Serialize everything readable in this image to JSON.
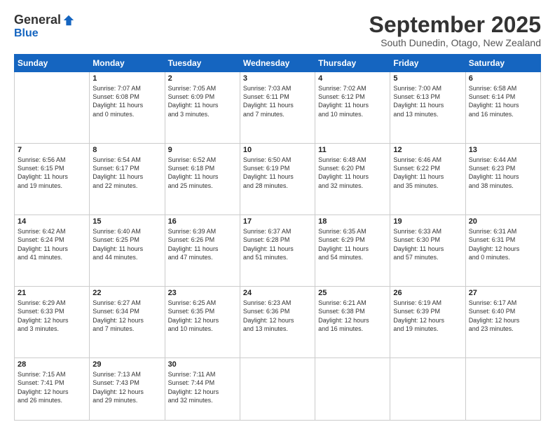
{
  "logo": {
    "general": "General",
    "blue": "Blue"
  },
  "header": {
    "month": "September 2025",
    "location": "South Dunedin, Otago, New Zealand"
  },
  "weekdays": [
    "Sunday",
    "Monday",
    "Tuesday",
    "Wednesday",
    "Thursday",
    "Friday",
    "Saturday"
  ],
  "weeks": [
    [
      {
        "day": "",
        "info": ""
      },
      {
        "day": "1",
        "info": "Sunrise: 7:07 AM\nSunset: 6:08 PM\nDaylight: 11 hours\nand 0 minutes."
      },
      {
        "day": "2",
        "info": "Sunrise: 7:05 AM\nSunset: 6:09 PM\nDaylight: 11 hours\nand 3 minutes."
      },
      {
        "day": "3",
        "info": "Sunrise: 7:03 AM\nSunset: 6:11 PM\nDaylight: 11 hours\nand 7 minutes."
      },
      {
        "day": "4",
        "info": "Sunrise: 7:02 AM\nSunset: 6:12 PM\nDaylight: 11 hours\nand 10 minutes."
      },
      {
        "day": "5",
        "info": "Sunrise: 7:00 AM\nSunset: 6:13 PM\nDaylight: 11 hours\nand 13 minutes."
      },
      {
        "day": "6",
        "info": "Sunrise: 6:58 AM\nSunset: 6:14 PM\nDaylight: 11 hours\nand 16 minutes."
      }
    ],
    [
      {
        "day": "7",
        "info": "Sunrise: 6:56 AM\nSunset: 6:15 PM\nDaylight: 11 hours\nand 19 minutes."
      },
      {
        "day": "8",
        "info": "Sunrise: 6:54 AM\nSunset: 6:17 PM\nDaylight: 11 hours\nand 22 minutes."
      },
      {
        "day": "9",
        "info": "Sunrise: 6:52 AM\nSunset: 6:18 PM\nDaylight: 11 hours\nand 25 minutes."
      },
      {
        "day": "10",
        "info": "Sunrise: 6:50 AM\nSunset: 6:19 PM\nDaylight: 11 hours\nand 28 minutes."
      },
      {
        "day": "11",
        "info": "Sunrise: 6:48 AM\nSunset: 6:20 PM\nDaylight: 11 hours\nand 32 minutes."
      },
      {
        "day": "12",
        "info": "Sunrise: 6:46 AM\nSunset: 6:22 PM\nDaylight: 11 hours\nand 35 minutes."
      },
      {
        "day": "13",
        "info": "Sunrise: 6:44 AM\nSunset: 6:23 PM\nDaylight: 11 hours\nand 38 minutes."
      }
    ],
    [
      {
        "day": "14",
        "info": "Sunrise: 6:42 AM\nSunset: 6:24 PM\nDaylight: 11 hours\nand 41 minutes."
      },
      {
        "day": "15",
        "info": "Sunrise: 6:40 AM\nSunset: 6:25 PM\nDaylight: 11 hours\nand 44 minutes."
      },
      {
        "day": "16",
        "info": "Sunrise: 6:39 AM\nSunset: 6:26 PM\nDaylight: 11 hours\nand 47 minutes."
      },
      {
        "day": "17",
        "info": "Sunrise: 6:37 AM\nSunset: 6:28 PM\nDaylight: 11 hours\nand 51 minutes."
      },
      {
        "day": "18",
        "info": "Sunrise: 6:35 AM\nSunset: 6:29 PM\nDaylight: 11 hours\nand 54 minutes."
      },
      {
        "day": "19",
        "info": "Sunrise: 6:33 AM\nSunset: 6:30 PM\nDaylight: 11 hours\nand 57 minutes."
      },
      {
        "day": "20",
        "info": "Sunrise: 6:31 AM\nSunset: 6:31 PM\nDaylight: 12 hours\nand 0 minutes."
      }
    ],
    [
      {
        "day": "21",
        "info": "Sunrise: 6:29 AM\nSunset: 6:33 PM\nDaylight: 12 hours\nand 3 minutes."
      },
      {
        "day": "22",
        "info": "Sunrise: 6:27 AM\nSunset: 6:34 PM\nDaylight: 12 hours\nand 7 minutes."
      },
      {
        "day": "23",
        "info": "Sunrise: 6:25 AM\nSunset: 6:35 PM\nDaylight: 12 hours\nand 10 minutes."
      },
      {
        "day": "24",
        "info": "Sunrise: 6:23 AM\nSunset: 6:36 PM\nDaylight: 12 hours\nand 13 minutes."
      },
      {
        "day": "25",
        "info": "Sunrise: 6:21 AM\nSunset: 6:38 PM\nDaylight: 12 hours\nand 16 minutes."
      },
      {
        "day": "26",
        "info": "Sunrise: 6:19 AM\nSunset: 6:39 PM\nDaylight: 12 hours\nand 19 minutes."
      },
      {
        "day": "27",
        "info": "Sunrise: 6:17 AM\nSunset: 6:40 PM\nDaylight: 12 hours\nand 23 minutes."
      }
    ],
    [
      {
        "day": "28",
        "info": "Sunrise: 7:15 AM\nSunset: 7:41 PM\nDaylight: 12 hours\nand 26 minutes."
      },
      {
        "day": "29",
        "info": "Sunrise: 7:13 AM\nSunset: 7:43 PM\nDaylight: 12 hours\nand 29 minutes."
      },
      {
        "day": "30",
        "info": "Sunrise: 7:11 AM\nSunset: 7:44 PM\nDaylight: 12 hours\nand 32 minutes."
      },
      {
        "day": "",
        "info": ""
      },
      {
        "day": "",
        "info": ""
      },
      {
        "day": "",
        "info": ""
      },
      {
        "day": "",
        "info": ""
      }
    ]
  ]
}
